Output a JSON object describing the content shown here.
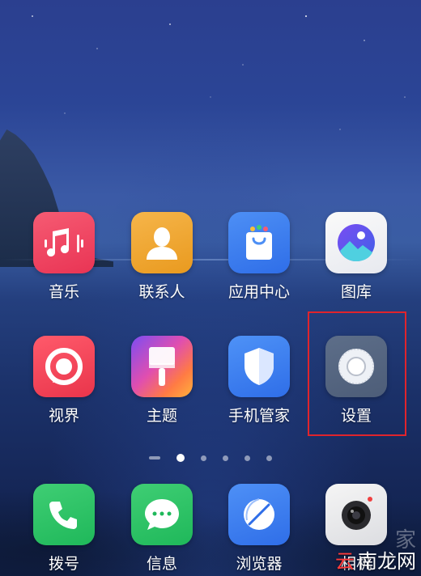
{
  "apps_row1": [
    {
      "label": "音乐",
      "icon": "music-icon"
    },
    {
      "label": "联系人",
      "icon": "contacts-icon"
    },
    {
      "label": "应用中心",
      "icon": "app-store-icon"
    },
    {
      "label": "图库",
      "icon": "gallery-icon"
    }
  ],
  "apps_row2": [
    {
      "label": "视界",
      "icon": "video-icon"
    },
    {
      "label": "主题",
      "icon": "theme-brush-icon"
    },
    {
      "label": "手机管家",
      "icon": "shield-icon"
    },
    {
      "label": "设置",
      "icon": "settings-gear-icon"
    }
  ],
  "dock": [
    {
      "label": "拨号",
      "icon": "phone-icon"
    },
    {
      "label": "信息",
      "icon": "message-icon"
    },
    {
      "label": "浏览器",
      "icon": "browser-icon"
    },
    {
      "label": "相机",
      "icon": "camera-icon"
    }
  ],
  "page_indicator": {
    "pages": 6,
    "current": 2
  },
  "highlight_target": "设置",
  "watermark": {
    "prefix": "云",
    "text": "南龙网",
    "logo": "家"
  },
  "colors": {
    "highlight_border": "#e0242c"
  }
}
